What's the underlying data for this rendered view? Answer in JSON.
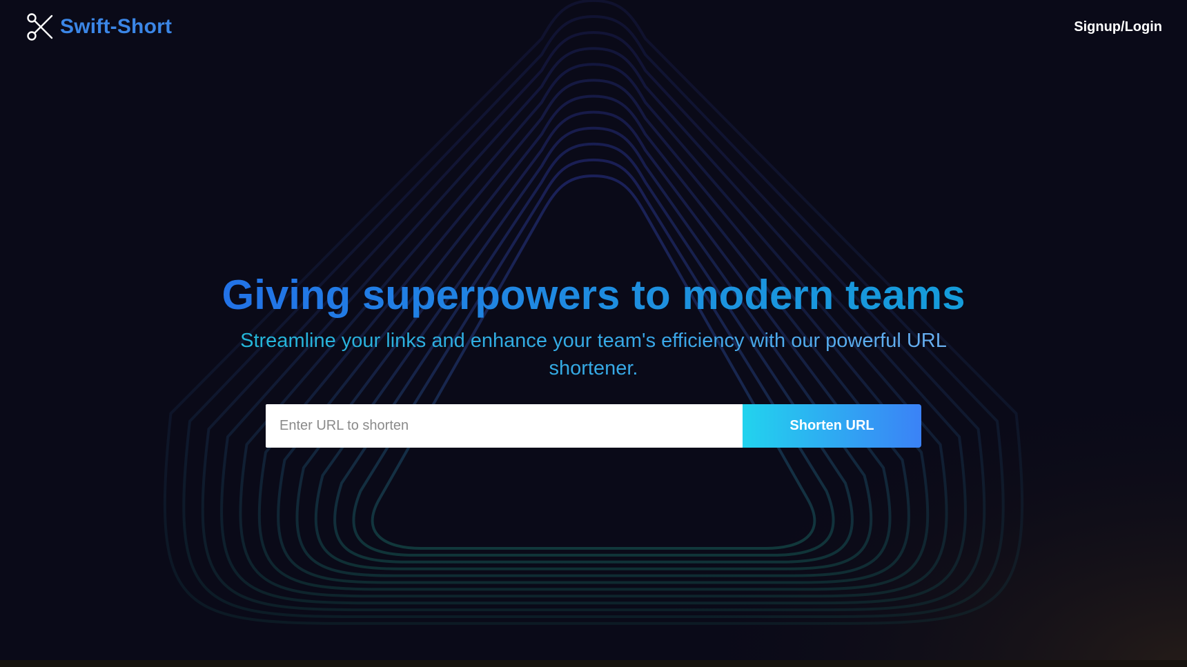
{
  "nav": {
    "brand_name": "Swift-Short",
    "brand_icon": "scissors-icon",
    "auth_link": "Signup/Login"
  },
  "hero": {
    "title": "Giving superpowers to modern teams",
    "subtitle": "Streamline your links and enhance your team's efficiency with our powerful URL shortener."
  },
  "form": {
    "url_placeholder": "Enter URL to shorten",
    "url_value": "",
    "submit_label": "Shorten URL"
  },
  "colors": {
    "background": "#0a0a18",
    "brand": "#3b86e6",
    "button_gradient_start": "#22d3ee",
    "button_gradient_end": "#3b82f6"
  }
}
